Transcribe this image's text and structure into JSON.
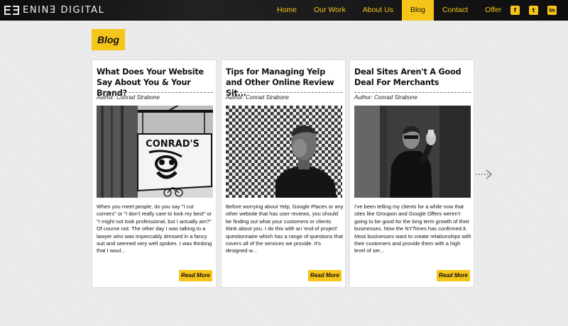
{
  "brand": {
    "name": "ENINƎ DIGITAL"
  },
  "nav": {
    "items": [
      {
        "label": "Home",
        "active": false
      },
      {
        "label": "Our Work",
        "active": false
      },
      {
        "label": "About Us",
        "active": false
      },
      {
        "label": "Blog",
        "active": true
      },
      {
        "label": "Contact",
        "active": false
      },
      {
        "label": "Offer",
        "active": false
      }
    ]
  },
  "social": [
    {
      "icon": "facebook-icon",
      "glyph": "f"
    },
    {
      "icon": "twitter-icon",
      "glyph": "t"
    },
    {
      "icon": "linkedin-icon",
      "glyph": "in"
    }
  ],
  "page": {
    "heading": "Blog"
  },
  "posts": [
    {
      "title": "What Does Your Website Say About You & Your Brand?",
      "author": "Author: Conrad Strabone",
      "image": "conrads-sign-photo",
      "excerpt": "When you meet people, do you say \"I cut corners\" or \"I don't really care to look my best\" or \"I might not look professional, but I actually am?\" Of course not. The other day I was talking to a lawyer who was impeccably dressed in a fancy suit and seemed very well spoken. I was thinking that I woul...",
      "more": "Read More",
      "sign_text": "CONRAD'S"
    },
    {
      "title": "Tips for Managing Yelp and Other Online Review Sit...",
      "author": "Author: Conrad Strabone",
      "image": "portrait-checkered-wall-photo",
      "excerpt": "Before worrying about Yelp, Google Places or any other website that has user reviews, you should be finding out what your customers or clients think about you. I do this with an 'end of project' questionnaire which has a range of questions that covers all of the services we provide. It's designed w...",
      "more": "Read More"
    },
    {
      "title": "Deal Sites Aren't A Good Deal For Merchants",
      "author": "Author: Conrad Strabone",
      "image": "man-in-doorway-photo",
      "excerpt": "I've been telling my clients for a while now that sites like Groupon and Google Offers weren't going to be good for the long term growth of their businesses. Now the NYTimes has confirmed it. Most businesses want to create relationships with their customers and provide them with a high level of ser...",
      "more": "Read More"
    }
  ],
  "colors": {
    "accent": "#f6c519",
    "header": "#141414",
    "background": "#ececec"
  }
}
